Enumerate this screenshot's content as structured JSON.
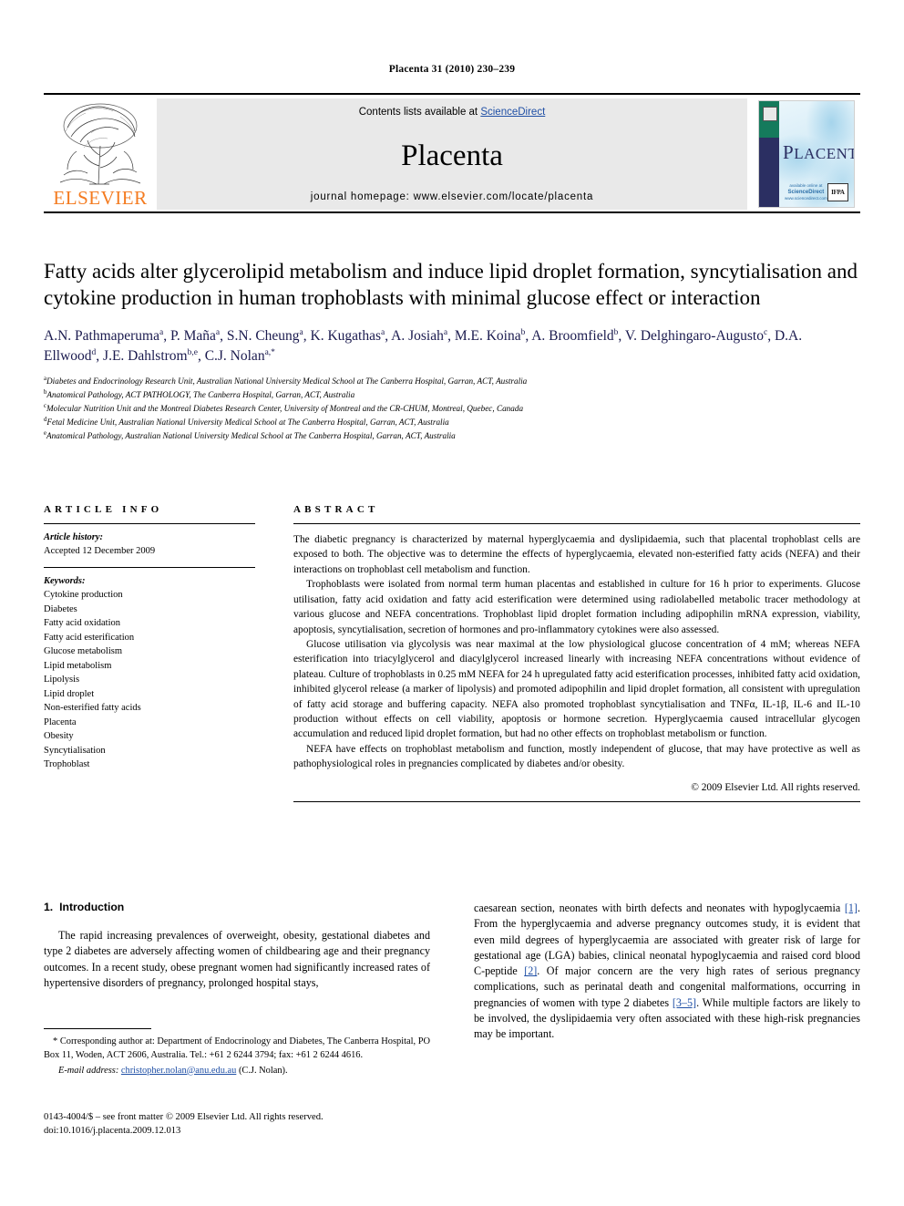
{
  "running_head": "Placenta 31 (2010) 230–239",
  "masthead": {
    "publisher": "ELSEVIER",
    "contents_prefix": "Contents lists available at ",
    "contents_link": "ScienceDirect",
    "journal_name": "Placenta",
    "homepage": "journal homepage: www.elsevier.com/locate/placenta",
    "cover": {
      "title_small_caps": "LACENTA",
      "title_initial": "P",
      "badge_sciencedirect_top": "available online at",
      "badge_sciencedirect": "ScienceDirect",
      "badge_sciencedirect_sub": "www.sciencedirect.com",
      "badge_ifpa": "IFPA"
    },
    "link_color": "#1F4FA5",
    "band_color": "#e9e9e9",
    "elsevier_orange": "#F47B20"
  },
  "article": {
    "title": "Fatty acids alter glycerolipid metabolism and induce lipid droplet formation, syncytialisation and cytokine production in human trophoblasts with minimal glucose effect or interaction",
    "authors": [
      {
        "name": "A.N. Pathmaperuma",
        "marks": "a",
        "sep": ", "
      },
      {
        "name": "P. Maña",
        "marks": "a",
        "sep": ", "
      },
      {
        "name": "S.N. Cheung",
        "marks": "a",
        "sep": ", "
      },
      {
        "name": "K. Kugathas",
        "marks": "a",
        "sep": ", "
      },
      {
        "name": "A. Josiah",
        "marks": "a",
        "sep": ", "
      },
      {
        "name": "M.E. Koina",
        "marks": "b",
        "sep": ", "
      },
      {
        "name": "A. Broomfield",
        "marks": "b",
        "sep": ", "
      },
      {
        "name": "V. Delghingaro-Augusto",
        "marks": "c",
        "sep": ", "
      },
      {
        "name": "D.A. Ellwood",
        "marks": "d",
        "sep": ", "
      },
      {
        "name": "J.E. Dahlstrom",
        "marks": "b,e",
        "sep": ", "
      },
      {
        "name": "C.J. Nolan",
        "marks": "a,*",
        "sep": ""
      }
    ],
    "author_color": "#1a1a4e",
    "affiliations": [
      {
        "mark": "a",
        "text": "Diabetes and Endocrinology Research Unit, Australian National University Medical School at The Canberra Hospital, Garran, ACT, Australia"
      },
      {
        "mark": "b",
        "text": "Anatomical Pathology, ACT PATHOLOGY, The Canberra Hospital, Garran, ACT, Australia"
      },
      {
        "mark": "c",
        "text": "Molecular Nutrition Unit and the Montreal Diabetes Research Center, University of Montreal and the CR-CHUM, Montreal, Quebec, Canada"
      },
      {
        "mark": "d",
        "text": "Fetal Medicine Unit, Australian National University Medical School at The Canberra Hospital, Garran, ACT, Australia"
      },
      {
        "mark": "e",
        "text": "Anatomical Pathology, Australian National University Medical School at The Canberra Hospital, Garran, ACT, Australia"
      }
    ]
  },
  "article_info": {
    "heading": "ARTICLE INFO",
    "history_label": "Article history:",
    "history_value": "Accepted 12 December 2009",
    "keywords_label": "Keywords:",
    "keywords": [
      "Cytokine production",
      "Diabetes",
      "Fatty acid oxidation",
      "Fatty acid esterification",
      "Glucose metabolism",
      "Lipid metabolism",
      "Lipolysis",
      "Lipid droplet",
      "Non-esterified fatty acids",
      "Placenta",
      "Obesity",
      "Syncytialisation",
      "Trophoblast"
    ]
  },
  "abstract": {
    "heading": "ABSTRACT",
    "paragraphs": [
      "The diabetic pregnancy is characterized by maternal hyperglycaemia and dyslipidaemia, such that placental trophoblast cells are exposed to both. The objective was to determine the effects of hyperglycaemia, elevated non-esterified fatty acids (NEFA) and their interactions on trophoblast cell metabolism and function.",
      "Trophoblasts were isolated from normal term human placentas and established in culture for 16 h prior to experiments. Glucose utilisation, fatty acid oxidation and fatty acid esterification were determined using radiolabelled metabolic tracer methodology at various glucose and NEFA concentrations. Trophoblast lipid droplet formation including adipophilin mRNA expression, viability, apoptosis, syncytialisation, secretion of hormones and pro-inflammatory cytokines were also assessed.",
      "Glucose utilisation via glycolysis was near maximal at the low physiological glucose concentration of 4 mM; whereas NEFA esterification into triacylglycerol and diacylglycerol increased linearly with increasing NEFA concentrations without evidence of plateau. Culture of trophoblasts in 0.25 mM NEFA for 24 h upregulated fatty acid esterification processes, inhibited fatty acid oxidation, inhibited glycerol release (a marker of lipolysis) and promoted adipophilin and lipid droplet formation, all consistent with upregulation of fatty acid storage and buffering capacity. NEFA also promoted trophoblast syncytialisation and TNFα, IL-1β, IL-6 and IL-10 production without effects on cell viability, apoptosis or hormone secretion. Hyperglycaemia caused intracellular glycogen accumulation and reduced lipid droplet formation, but had no other effects on trophoblast metabolism or function.",
      "NEFA have effects on trophoblast metabolism and function, mostly independent of glucose, that may have protective as well as pathophysiological roles in pregnancies complicated by diabetes and/or obesity."
    ],
    "copyright": "© 2009 Elsevier Ltd. All rights reserved."
  },
  "introduction": {
    "number": "1.",
    "heading": "Introduction",
    "left_paragraph": "The rapid increasing prevalences of overweight, obesity, gestational diabetes and type 2 diabetes are adversely affecting women of childbearing age and their pregnancy outcomes. In a recent study, obese pregnant women had significantly increased rates of hypertensive disorders of pregnancy, prolonged hospital stays,",
    "right_paragraph_parts": [
      {
        "text": "caesarean section, neonates with birth defects and neonates with hypoglycaemia "
      },
      {
        "ref": "[1]"
      },
      {
        "text": ". From the hyperglycaemia and adverse pregnancy outcomes study, it is evident that even mild degrees of hyperglycaemia are associated with greater risk of large for gestational age (LGA) babies, clinical neonatal hypoglycaemia and raised cord blood C-peptide "
      },
      {
        "ref": "[2]"
      },
      {
        "text": ". Of major concern are the very high rates of serious pregnancy complications, such as perinatal death and congenital malformations, occurring in pregnancies of women with type 2 diabetes "
      },
      {
        "ref": "[3–5]"
      },
      {
        "text": ". While multiple factors are likely to be involved, the dyslipidaemia very often associated with these high-risk pregnancies may be important."
      }
    ]
  },
  "footnote": {
    "corresponding": "* Corresponding author at: Department of Endocrinology and Diabetes, The Canberra Hospital, PO Box 11, Woden, ACT 2606, Australia. Tel.: +61 2 6244 3794; fax: +61 2 6244 4616.",
    "email_label": "E-mail address:",
    "email": "christopher.nolan@anu.edu.au",
    "email_owner": "(C.J. Nolan)."
  },
  "imprint": {
    "line1": "0143-4004/$ – see front matter © 2009 Elsevier Ltd. All rights reserved.",
    "line2": "doi:10.1016/j.placenta.2009.12.013"
  }
}
